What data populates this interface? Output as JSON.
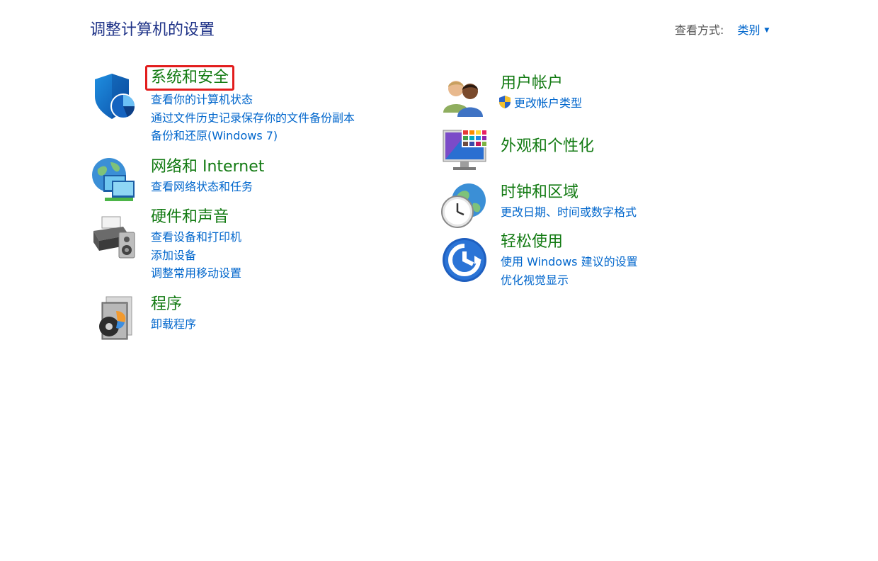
{
  "page": {
    "title": "调整计算机的设置"
  },
  "view_by": {
    "label": "查看方式:",
    "value": "类别",
    "caret_icon": "triangle-down"
  },
  "colors": {
    "title_blue": "#1e3287",
    "category_green": "#127a12",
    "link_blue": "#0066cc",
    "highlight_red": "#e21d1d"
  },
  "categories": {
    "system_security": {
      "title": "系统和安全",
      "icon": "shield-icon",
      "highlighted": true,
      "links": [
        "查看你的计算机状态",
        "通过文件历史记录保存你的文件备份副本",
        "备份和还原(Windows 7)"
      ]
    },
    "network": {
      "title": "网络和 Internet",
      "icon": "network-globe-icon",
      "links": [
        "查看网络状态和任务"
      ]
    },
    "hardware": {
      "title": "硬件和声音",
      "icon": "printer-speaker-icon",
      "links": [
        "查看设备和打印机",
        "添加设备",
        "调整常用移动设置"
      ]
    },
    "programs": {
      "title": "程序",
      "icon": "programs-disc-icon",
      "links": [
        "卸载程序"
      ]
    },
    "user_accounts": {
      "title": "用户帐户",
      "icon": "users-icon",
      "links": [
        "更改帐户类型"
      ],
      "link_icon": "uac-shield-icon"
    },
    "appearance": {
      "title": "外观和个性化",
      "icon": "monitor-palette-icon",
      "links": []
    },
    "clock_region": {
      "title": "时钟和区域",
      "icon": "clock-globe-icon",
      "links": [
        "更改日期、时间或数字格式"
      ]
    },
    "ease_access": {
      "title": "轻松使用",
      "icon": "ease-of-access-icon",
      "links": [
        "使用 Windows 建议的设置",
        "优化视觉显示"
      ]
    }
  }
}
